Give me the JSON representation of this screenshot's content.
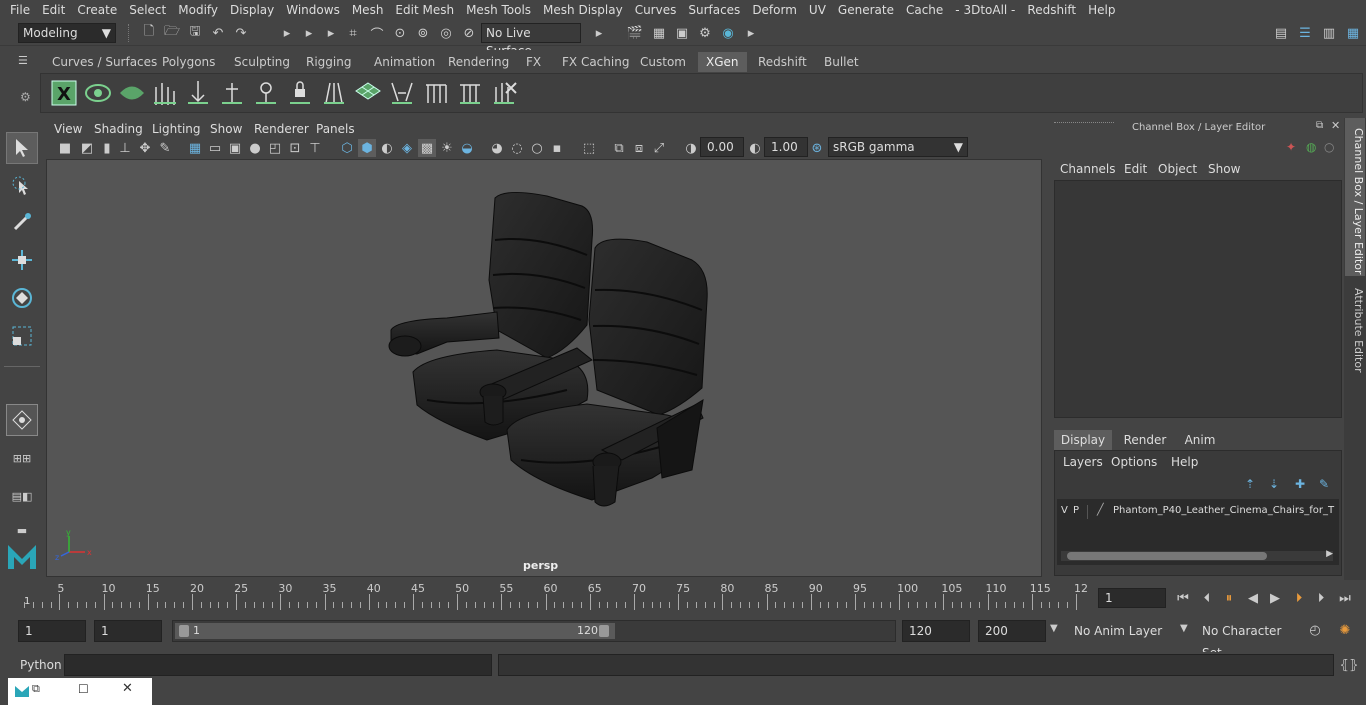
{
  "menubar": {
    "items": [
      "File",
      "Edit",
      "Create",
      "Select",
      "Modify",
      "Display",
      "Windows",
      "Mesh",
      "Edit Mesh",
      "Mesh Tools",
      "Mesh Display",
      "Curves",
      "Surfaces",
      "Deform",
      "UV",
      "Generate",
      "Cache",
      "- 3DtoAll -",
      "Redshift",
      "Help"
    ]
  },
  "statusline": {
    "mode": "Modeling",
    "live_surface": "No Live Surface"
  },
  "shelf": {
    "tabs": [
      "Curves / Surfaces",
      "Polygons",
      "Sculpting",
      "Rigging",
      "Animation",
      "Rendering",
      "FX",
      "FX Caching",
      "Custom",
      "XGen",
      "Redshift",
      "Bullet"
    ],
    "active_tab": "XGen"
  },
  "viewport": {
    "menu": [
      "View",
      "Shading",
      "Lighting",
      "Show",
      "Renderer",
      "Panels"
    ],
    "exposure": "0.00",
    "gamma": "1.00",
    "colorspace": "sRGB gamma",
    "camera_label": "persp"
  },
  "channelbox": {
    "title": "Channel Box / Layer Editor",
    "menu": [
      "Channels",
      "Edit",
      "Object",
      "Show"
    ],
    "layer_tabs": [
      "Display",
      "Render",
      "Anim"
    ],
    "active_layer_tab": "Display",
    "layer_menu": [
      "Layers",
      "Options",
      "Help"
    ],
    "layer_row": {
      "v": "V",
      "p": "P",
      "name": "Phantom_P40_Leather_Cinema_Chairs_for_T"
    }
  },
  "side_tabs": [
    "Channel Box / Layer Editor",
    "Attribute Editor"
  ],
  "timeline": {
    "ticks": [
      "5",
      "10",
      "15",
      "20",
      "25",
      "30",
      "35",
      "40",
      "45",
      "50",
      "55",
      "60",
      "65",
      "70",
      "75",
      "80",
      "85",
      "90",
      "95",
      "100",
      "105",
      "110",
      "115",
      "12"
    ],
    "start_marker": "1",
    "current_frame": "1"
  },
  "range": {
    "start": "1",
    "playback_start": "1",
    "slider_start": "1",
    "slider_end": "120",
    "playback_end": "120",
    "end": "200",
    "anim_layer": "No Anim Layer",
    "character_set": "No Character Set"
  },
  "cmd": {
    "label": "Python"
  },
  "colors": {
    "accent": "#5285a6",
    "xgen_green": "#5aa469",
    "bg": "#444444"
  }
}
